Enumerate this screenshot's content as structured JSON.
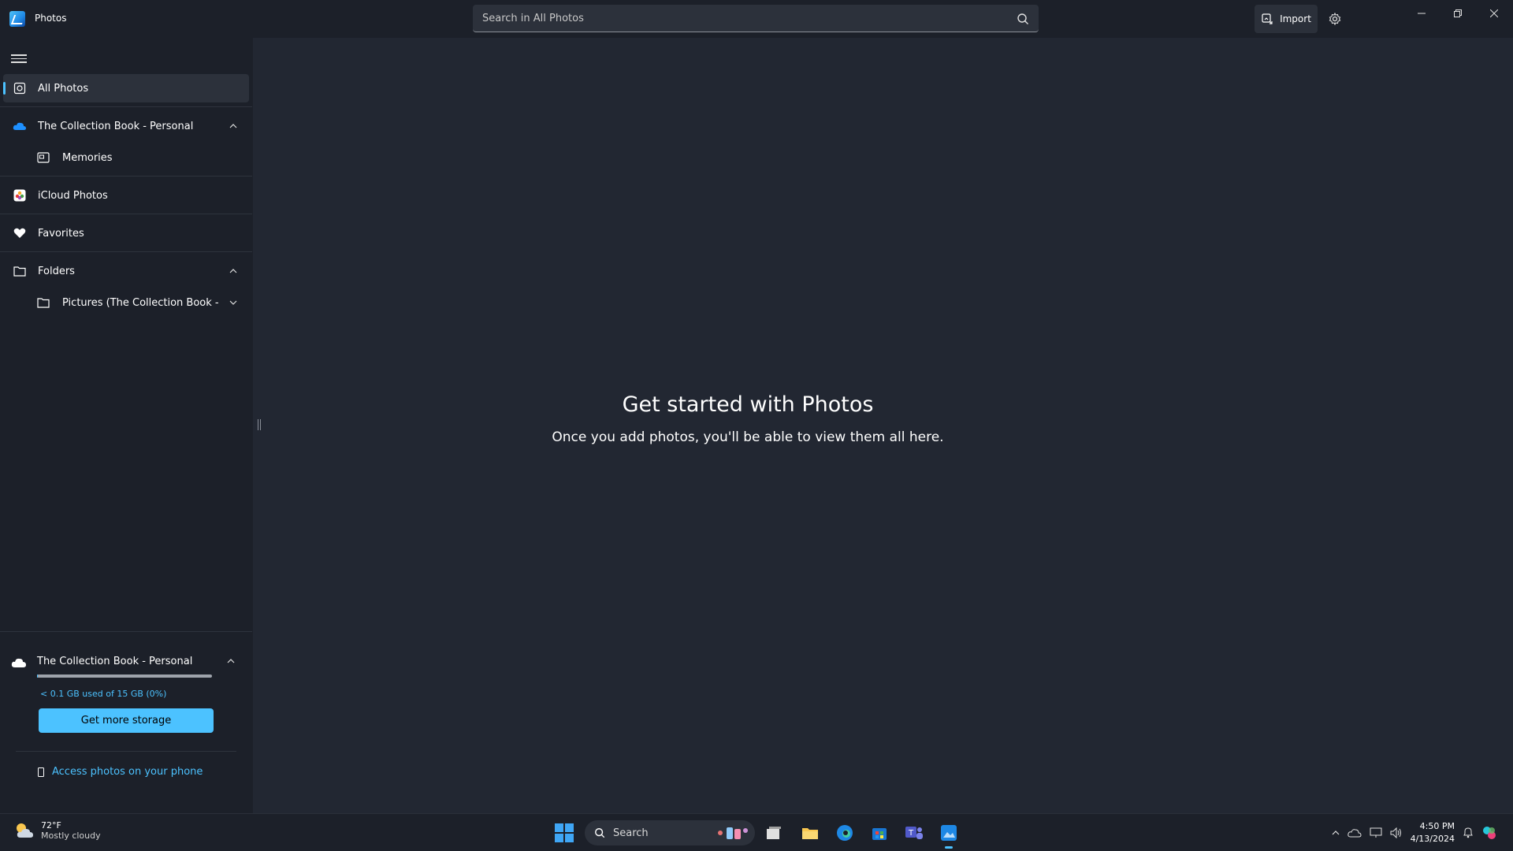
{
  "app": {
    "title": "Photos",
    "search_placeholder": "Search in All Photos",
    "import_label": "Import"
  },
  "sidebar": {
    "items": [
      {
        "label": "All Photos",
        "icon": "all-photos-icon"
      },
      {
        "label": "The Collection Book - Personal",
        "icon": "onedrive-icon"
      },
      {
        "label": "Memories",
        "icon": "memories-icon"
      },
      {
        "label": "iCloud Photos",
        "icon": "icloud-icon"
      },
      {
        "label": "Favorites",
        "icon": "heart-icon"
      },
      {
        "label": "Folders",
        "icon": "folder-icon"
      },
      {
        "label": "Pictures (The Collection Book -",
        "icon": "folder-icon"
      }
    ],
    "storage": {
      "account": "The Collection Book - Personal",
      "used_text": "< 0.1 GB used of 15 GB (0%)",
      "used_fraction": 0.0,
      "cta": "Get more storage",
      "phone_link": "Access photos on your phone"
    }
  },
  "main": {
    "empty_title": "Get started with Photos",
    "empty_subtitle": "Once you add photos, you'll be able to view them all here."
  },
  "taskbar": {
    "weather_temp": "72°F",
    "weather_desc": "Mostly cloudy",
    "search_label": "Search",
    "time": "4:50 PM",
    "date": "4/13/2024"
  },
  "colors": {
    "accent": "#4cc2ff",
    "background": "#1c2029",
    "main_bg": "#222732"
  }
}
